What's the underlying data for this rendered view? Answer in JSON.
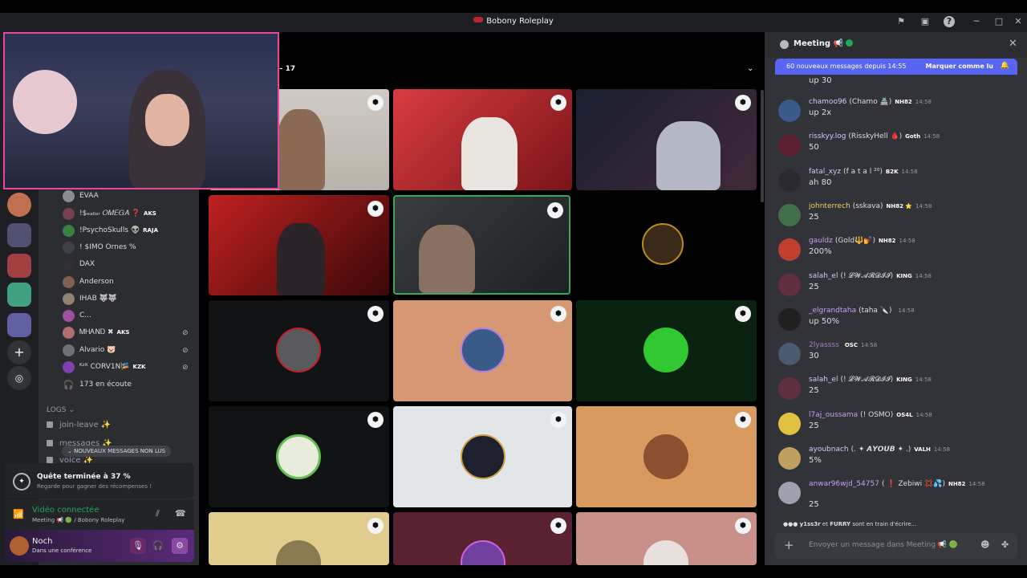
{
  "window": {
    "title": "Bobony Roleplay"
  },
  "stage": {
    "participant_count": "– 17"
  },
  "members": [
    {
      "name": "EVAA",
      "badge": "",
      "color": "#dbdee1"
    },
    {
      "name": "!$ₑₐₗᵢₒᵣ 𝑂𝑀𝐸𝐺𝐴 ❓",
      "badge": "AKS",
      "color": "#dbdee1"
    },
    {
      "name": "!PsychoSkulls 👽",
      "badge": "RAJA",
      "color": "#dbdee1"
    },
    {
      "name": "! $IMO Ornes %",
      "badge": "",
      "color": "#dbdee1"
    },
    {
      "name": "DAX",
      "badge": "",
      "color": "#dbdee1"
    },
    {
      "name": "Anderson",
      "badge": "",
      "color": "#dbdee1"
    },
    {
      "name": "IHAB 🐺🐺",
      "badge": "",
      "color": "#dbdee1"
    },
    {
      "name": "C...",
      "badge": "",
      "color": "#dbdee1"
    },
    {
      "name": "ᎷᎻᎪNᎠ ✖",
      "badge": "AKS",
      "color": "#dbdee1"
    },
    {
      "name": "Alvario 🐷",
      "badge": "",
      "color": "#dbdee1"
    },
    {
      "name": "ᴷᶻᴷ CORV1N🎏",
      "badge": "KZK",
      "color": "#dbdee1"
    }
  ],
  "listeners": "173 en écoute",
  "logs": {
    "section": "LOGS",
    "channels": [
      "join-leave ✨",
      "messages ✨",
      "voice ✨"
    ]
  },
  "unread_pill": "NOUVEAUX MESSAGES NON LUS",
  "quest": {
    "title": "Quête terminée à 37 %",
    "subtitle": "Regarde pour gagner des récompenses !"
  },
  "voice": {
    "status": "Vidéo connectée",
    "channel": "Meeting 📢 🟢 / Bobony Roleplay"
  },
  "user": {
    "name": "Noch",
    "status": "Dans une conférence"
  },
  "chat": {
    "title": "Meeting 📢",
    "new_messages": "60 nouveaux messages depuis 14:55",
    "mark_read": "Marquer comme lu",
    "first_text": "up 30",
    "messages": [
      {
        "name": "chamoo96",
        "nick": "(Chamo 🏯)",
        "badge": "NH82",
        "time": "14:58",
        "text": "up 2x",
        "name_color": "#c9cdfb"
      },
      {
        "name": "risskyy.log",
        "nick": "(RisskyHell 🩸)",
        "badge": "Goth",
        "time": "14:58",
        "text": "50",
        "name_color": "#c9cdfb"
      },
      {
        "name": "fatal_xyz",
        "nick": "(f a t a l ²⁰)",
        "badge": "B2K",
        "time": "14:58",
        "text": "ah 80",
        "name_color": "#c9cdfb"
      },
      {
        "name": "johnterrech",
        "nick": "(sskava)",
        "badge": "NH82 ⭐",
        "time": "14:58",
        "text": "25",
        "name_color": "#f0d060"
      },
      {
        "name": "gauldz",
        "nick": "(Gold🔱💅)",
        "badge": "NH82",
        "time": "14:58",
        "text": "200%",
        "name_color": "#c9a0f0"
      },
      {
        "name": "salah_el",
        "nick": "(! 𝓛𝓦𝓐𝓡𝓓𝓘𝓘)",
        "badge": "KING",
        "time": "14:58",
        "text": "25",
        "name_color": "#c9cdfb"
      },
      {
        "name": "_elgrandtaha",
        "nick": "(taha 🔪)",
        "badge": "",
        "time": "14:58",
        "text": "up 50%",
        "name_color": "#c9a0f0"
      },
      {
        "name": "2lyassss",
        "nick": "",
        "badge": "OSC",
        "time": "14:58",
        "text": "30",
        "name_color": "#a080c0"
      },
      {
        "name": "salah_el",
        "nick": "(! 𝓛𝓦𝓐𝓡𝓓𝓘𝓘)",
        "badge": "KING",
        "time": "14:58",
        "text": "25",
        "name_color": "#c9cdfb"
      },
      {
        "name": "l7aj_oussama",
        "nick": "(! OSMO)",
        "badge": "OS4L",
        "time": "14:58",
        "text": "25",
        "name_color": "#c9a0f0"
      },
      {
        "name": "ayoubnach",
        "nick": "(. ✦ 𝘼𝙔𝙊𝙐𝘽 ✦ .)",
        "badge": "VALH",
        "time": "14:58",
        "text": "5%",
        "name_color": "#c9cdfb"
      },
      {
        "name": "anwar96wjd_54757",
        "nick": "( ❗ Zebiwi 💢💦)",
        "badge": "NH82",
        "time": "14:58",
        "text": "25",
        "name_color": "#c9a0f0"
      }
    ],
    "typing_names": "y1ss3r",
    "typing_and": "et",
    "typing_names2": "FURRY",
    "typing_suffix": "sont en train d'écrire...",
    "composer_placeholder": "Envoyer un message dans Meeting 📢 🟢"
  },
  "colors": {
    "accent": "#5865f2",
    "connected": "#23a55a",
    "pip_border": "#eb459e"
  }
}
